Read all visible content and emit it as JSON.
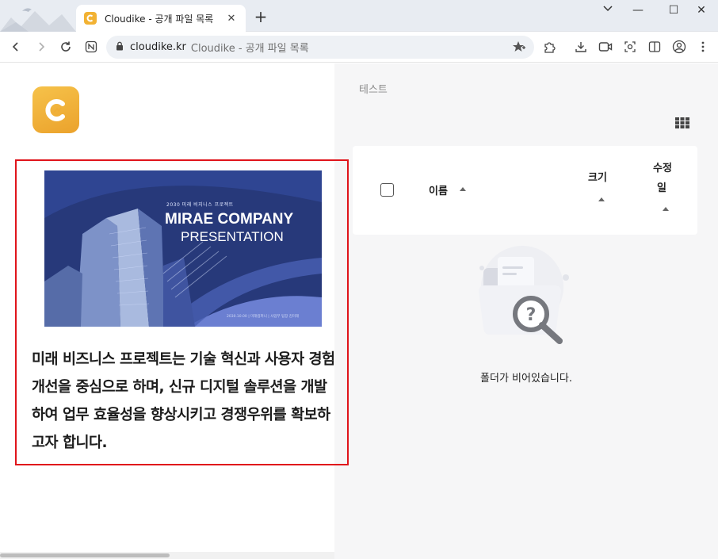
{
  "browser": {
    "tab_title": "Cloudike - 공개 파일 목록",
    "tab_close": "✕",
    "new_tab": "+",
    "minimize": "—",
    "maximize": "☐",
    "close": "✕",
    "url_domain": "cloudike.kr",
    "url_page_title": "Cloudike - 공개 파일 목록"
  },
  "preview": {
    "slide": {
      "subtitle": "2030 미래 비지니스 프로젝트",
      "title_line1": "MIRAE COMPANY",
      "title_line2": "PRESENTATION",
      "footer": "2030.10.00  |  미래컴퍼니  |  사업부 팀장 김미래"
    },
    "description": "미래 비즈니스 프로젝트는 기술 혁신과 사용자 경험 개선을 중심으로 하며, 신규 디지털 솔루션을 개발하여 업무 효율성을 향상시키고 경쟁우위를 확보하고자 합니다."
  },
  "files": {
    "breadcrumb": "테스트",
    "columns": {
      "name": "이름",
      "size": "크기",
      "modified_line1": "수정",
      "modified_line2": "일"
    },
    "empty_message": "폴더가 비어있습니다."
  },
  "colors": {
    "accent": "#f2b233",
    "highlight_border": "#e0141b",
    "slide_bg": "#27397a"
  }
}
